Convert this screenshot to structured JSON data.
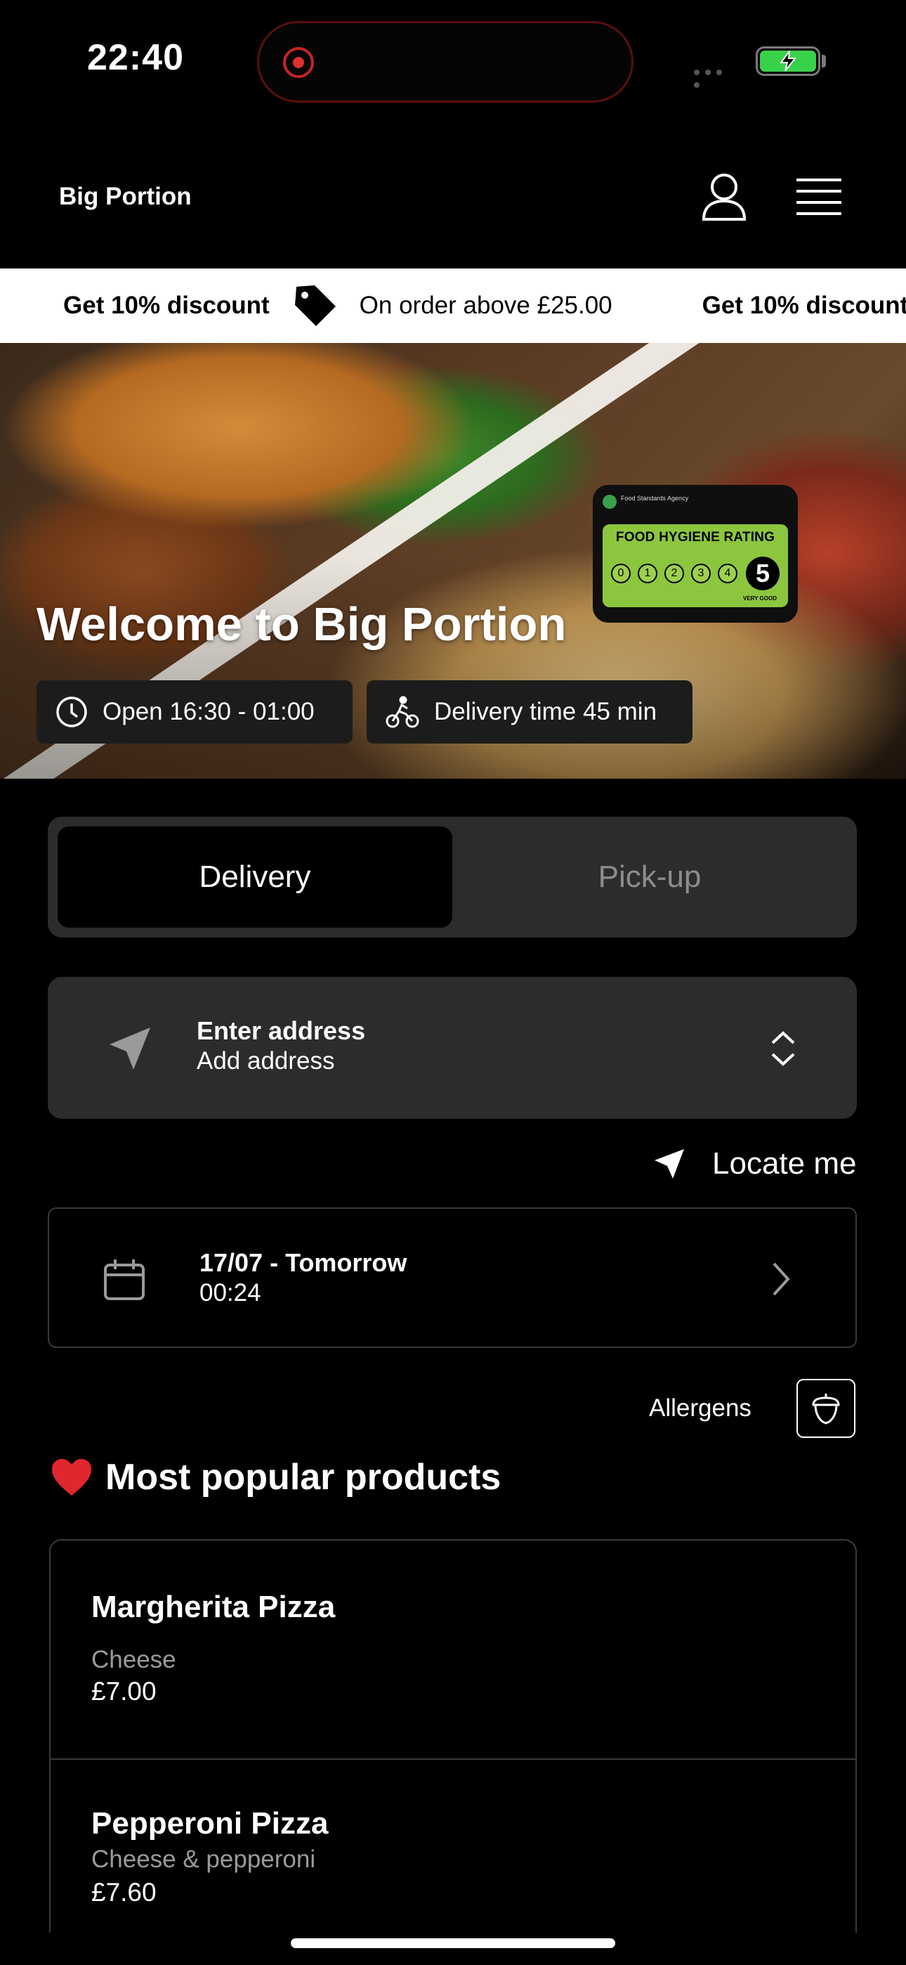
{
  "status_bar": {
    "time": "22:40"
  },
  "header": {
    "brand": "Big Portion"
  },
  "promo": {
    "title": "Get 10% discount",
    "subtitle": "On order above £25.00",
    "title_repeat": "Get 10% discount"
  },
  "hero": {
    "welcome": "Welcome to Big Portion",
    "hygiene_badge": {
      "title": "FOOD HYGIENE RATING",
      "header_text": "Food Standards Agency",
      "scale": [
        "0",
        "1",
        "2",
        "3",
        "4"
      ],
      "rating": "5",
      "footer": "VERY GOOD"
    },
    "open_hours": "Open 16:30 - 01:00",
    "delivery_time": "Delivery time 45 min"
  },
  "order_mode": {
    "options": [
      "Delivery",
      "Pick-up"
    ],
    "selected": "Delivery"
  },
  "address": {
    "title": "Enter address",
    "subtitle": "Add address"
  },
  "locate_label": "Locate me",
  "schedule": {
    "date": "17/07 - Tomorrow",
    "time": "00:24"
  },
  "allergens_label": "Allergens",
  "popular": {
    "title": "Most popular products",
    "products": [
      {
        "name": "Margherita Pizza",
        "description": "Cheese",
        "price": "£7.00"
      },
      {
        "name": "Pepperoni Pizza",
        "description": "Cheese & pepperoni",
        "price": "£7.60"
      }
    ]
  },
  "colors": {
    "background": "#000000",
    "card": "#2c2c2c",
    "battery": "#3ad14a",
    "hygiene_green": "#8cc63f"
  }
}
